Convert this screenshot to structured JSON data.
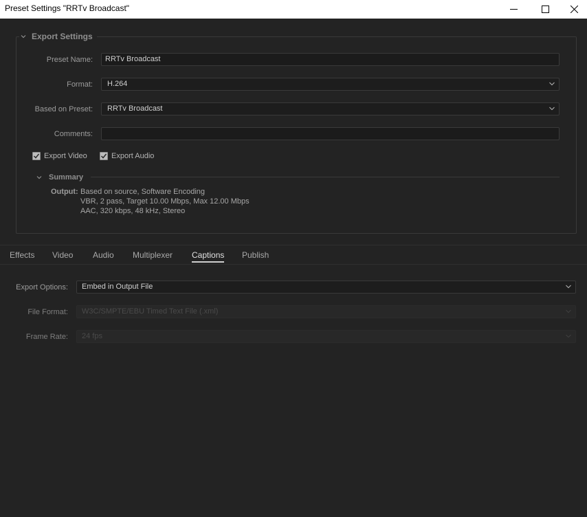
{
  "window": {
    "title": "Preset Settings \"RRTv Broadcast\""
  },
  "export_settings": {
    "header": "Export Settings",
    "preset_name_label": "Preset Name:",
    "preset_name_value": "RRTv Broadcast",
    "format_label": "Format:",
    "format_value": "H.264",
    "based_on_label": "Based on Preset:",
    "based_on_value": "RRTv Broadcast",
    "comments_label": "Comments:",
    "comments_value": "",
    "export_video_label": "Export Video",
    "export_video_checked": true,
    "export_audio_label": "Export Audio",
    "export_audio_checked": true
  },
  "summary": {
    "header": "Summary",
    "output_label": "Output:",
    "output_lines": [
      "Based on source, Software Encoding",
      "VBR, 2 pass, Target 10.00 Mbps, Max 12.00 Mbps",
      "AAC, 320 kbps, 48 kHz, Stereo"
    ]
  },
  "tabs": [
    {
      "label": "Effects"
    },
    {
      "label": "Video"
    },
    {
      "label": "Audio"
    },
    {
      "label": "Multiplexer"
    },
    {
      "label": "Captions",
      "active": true
    },
    {
      "label": "Publish"
    }
  ],
  "captions": {
    "export_options_label": "Export Options:",
    "export_options_value": "Embed in Output File",
    "file_format_label": "File Format:",
    "file_format_value": "W3C/SMPTE/EBU Timed Text File (.xml)",
    "frame_rate_label": "Frame Rate:",
    "frame_rate_value": "24 fps"
  },
  "icons": {
    "minimize": "minimize-icon",
    "maximize": "maximize-icon",
    "close": "close-icon",
    "collapse": "chevron-down-icon",
    "dropdown": "chevron-down-icon",
    "checkbox": "checkmark-icon"
  },
  "colors": {
    "background": "#232323",
    "field_bg": "#1b1b1b",
    "border": "#3a3a3a",
    "title_bar": "#ffffff"
  }
}
